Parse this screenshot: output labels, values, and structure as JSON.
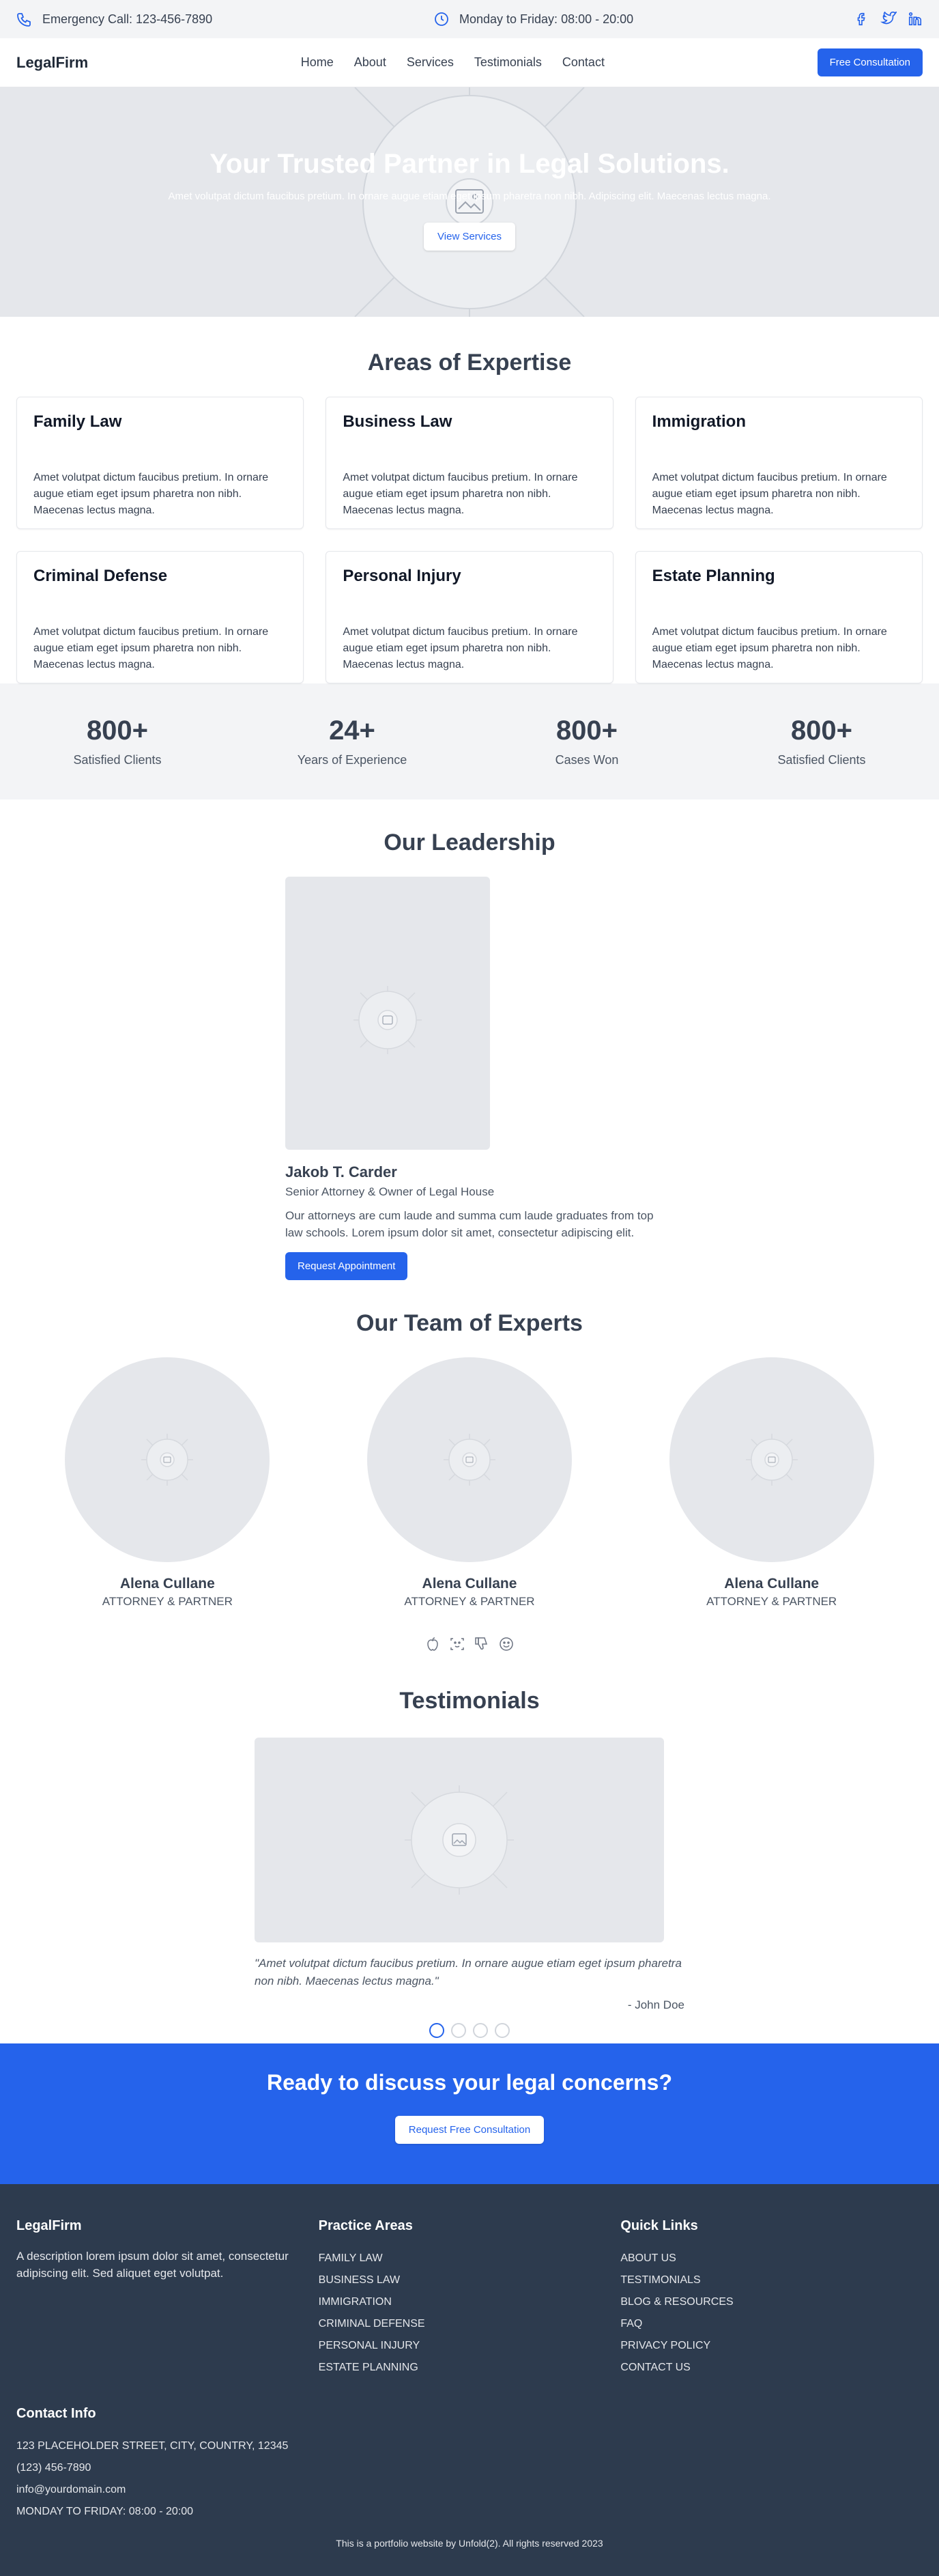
{
  "colors": {
    "primary": "#2563eb",
    "footer_bg": "#2d3b4e",
    "placeholder": "#e5e7eb"
  },
  "topbar": {
    "emergency": "Emergency Call: 123-456-7890",
    "hours": "Monday to Friday: 08:00 - 20:00",
    "icons": [
      "phone-icon",
      "clock-icon",
      "facebook-icon",
      "twitter-icon",
      "linkedin-icon"
    ]
  },
  "nav": {
    "logo": "LegalFirm",
    "links": [
      "Home",
      "About",
      "Services",
      "Testimonials",
      "Contact"
    ],
    "cta": "Free Consultation"
  },
  "hero": {
    "title": "Your Trusted Partner in Legal Solutions.",
    "subtitle": "Amet volutpat dictum faucibus pretium. In ornare augue etiam eget ipsum pharetra non nibh. Adipiscing elit. Maecenas lectus magna.",
    "button": "View Services"
  },
  "expertise": {
    "title": "Areas of Expertise",
    "cards": [
      {
        "title": "Family Law",
        "text": "Amet volutpat dictum faucibus pretium. In ornare augue etiam eget ipsum pharetra non nibh. Maecenas lectus magna."
      },
      {
        "title": "Business Law",
        "text": "Amet volutpat dictum faucibus pretium. In ornare augue etiam eget ipsum pharetra non nibh. Maecenas lectus magna."
      },
      {
        "title": "Immigration",
        "text": "Amet volutpat dictum faucibus pretium. In ornare augue etiam eget ipsum pharetra non nibh. Maecenas lectus magna."
      },
      {
        "title": "Criminal Defense",
        "text": "Amet volutpat dictum faucibus pretium. In ornare augue etiam eget ipsum pharetra non nibh. Maecenas lectus magna."
      },
      {
        "title": "Personal Injury",
        "text": "Amet volutpat dictum faucibus pretium. In ornare augue etiam eget ipsum pharetra non nibh. Maecenas lectus magna."
      },
      {
        "title": "Estate Planning",
        "text": "Amet volutpat dictum faucibus pretium. In ornare augue etiam eget ipsum pharetra non nibh. Maecenas lectus magna."
      }
    ]
  },
  "stats": [
    {
      "value": "800+",
      "label": "Satisfied Clients"
    },
    {
      "value": "24+",
      "label": "Years of Experience"
    },
    {
      "value": "800+",
      "label": "Cases Won"
    },
    {
      "value": "800+",
      "label": "Satisfied Clients"
    }
  ],
  "leadership": {
    "title": "Our Leadership",
    "name": "Jakob T. Carder",
    "role": "Senior Attorney & Owner of Legal House",
    "description": "Our attorneys are cum laude and summa cum laude graduates from top law schools. Lorem ipsum dolor sit amet, consectetur adipiscing elit.",
    "button": "Request Appointment"
  },
  "team": {
    "title": "Our Team of Experts",
    "members": [
      {
        "name": "Alena Cullane",
        "role": "ATTORNEY & PARTNER"
      },
      {
        "name": "Alena Cullane",
        "role": "ATTORNEY & PARTNER"
      },
      {
        "name": "Alena Cullane",
        "role": "ATTORNEY & PARTNER"
      }
    ],
    "icons": [
      "apple-icon",
      "scan-face-icon",
      "thumbs-down-icon",
      "smile-icon"
    ]
  },
  "testimonials": {
    "title": "Testimonials",
    "quote": "\"Amet volutpat dictum faucibus pretium. In ornare augue etiam eget ipsum pharetra non nibh. Maecenas lectus magna.\"",
    "author": "- John Doe"
  },
  "cta": {
    "title": "Ready to discuss your legal concerns?",
    "button": "Request Free Consultation"
  },
  "footer": {
    "brand": "LegalFirm",
    "description": "A description lorem ipsum dolor sit amet, consectetur adipiscing elit. Sed aliquet eget volutpat.",
    "practice_title": "Practice Areas",
    "practice": [
      "FAMILY LAW",
      "BUSINESS LAW",
      "IMMIGRATION",
      "CRIMINAL DEFENSE",
      "PERSONAL INJURY",
      "ESTATE PLANNING"
    ],
    "links_title": "Quick Links",
    "links": [
      "ABOUT US",
      "TESTIMONIALS",
      "BLOG & RESOURCES",
      "FAQ",
      "PRIVACY POLICY",
      "CONTACT US"
    ],
    "contact_title": "Contact Info",
    "contact": [
      "123 PLACEHOLDER STREET, CITY, COUNTRY, 12345",
      "(123) 456-7890",
      "info@yourdomain.com",
      "MONDAY TO FRIDAY: 08:00 - 20:00"
    ],
    "copyright": "This is a portfolio website by Unfold(2). All rights reserved 2023"
  }
}
